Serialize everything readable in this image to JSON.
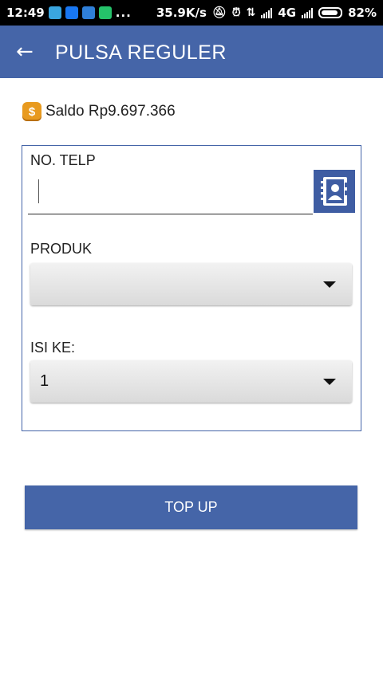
{
  "status_bar": {
    "time": "12:49",
    "more": "...",
    "speed": "35.9K/s",
    "network": "4G",
    "battery": "82%",
    "app_icon_colors": [
      "#3aa6e0",
      "#1877f2",
      "#2f7fd8",
      "#25c26a"
    ]
  },
  "app_bar": {
    "back_glyph": "←",
    "title": "PULSA REGULER",
    "color": "#4565a8"
  },
  "balance": {
    "label": "Saldo Rp9.697.366",
    "icon": "money-bag-icon"
  },
  "form": {
    "phone": {
      "label": "NO. TELP",
      "value": "",
      "contact_icon": "contacts-book-icon"
    },
    "product": {
      "label": "PRODUK",
      "selected": ""
    },
    "count": {
      "label": "ISI KE:",
      "selected": "1"
    }
  },
  "actions": {
    "topup_label": "TOP UP"
  }
}
